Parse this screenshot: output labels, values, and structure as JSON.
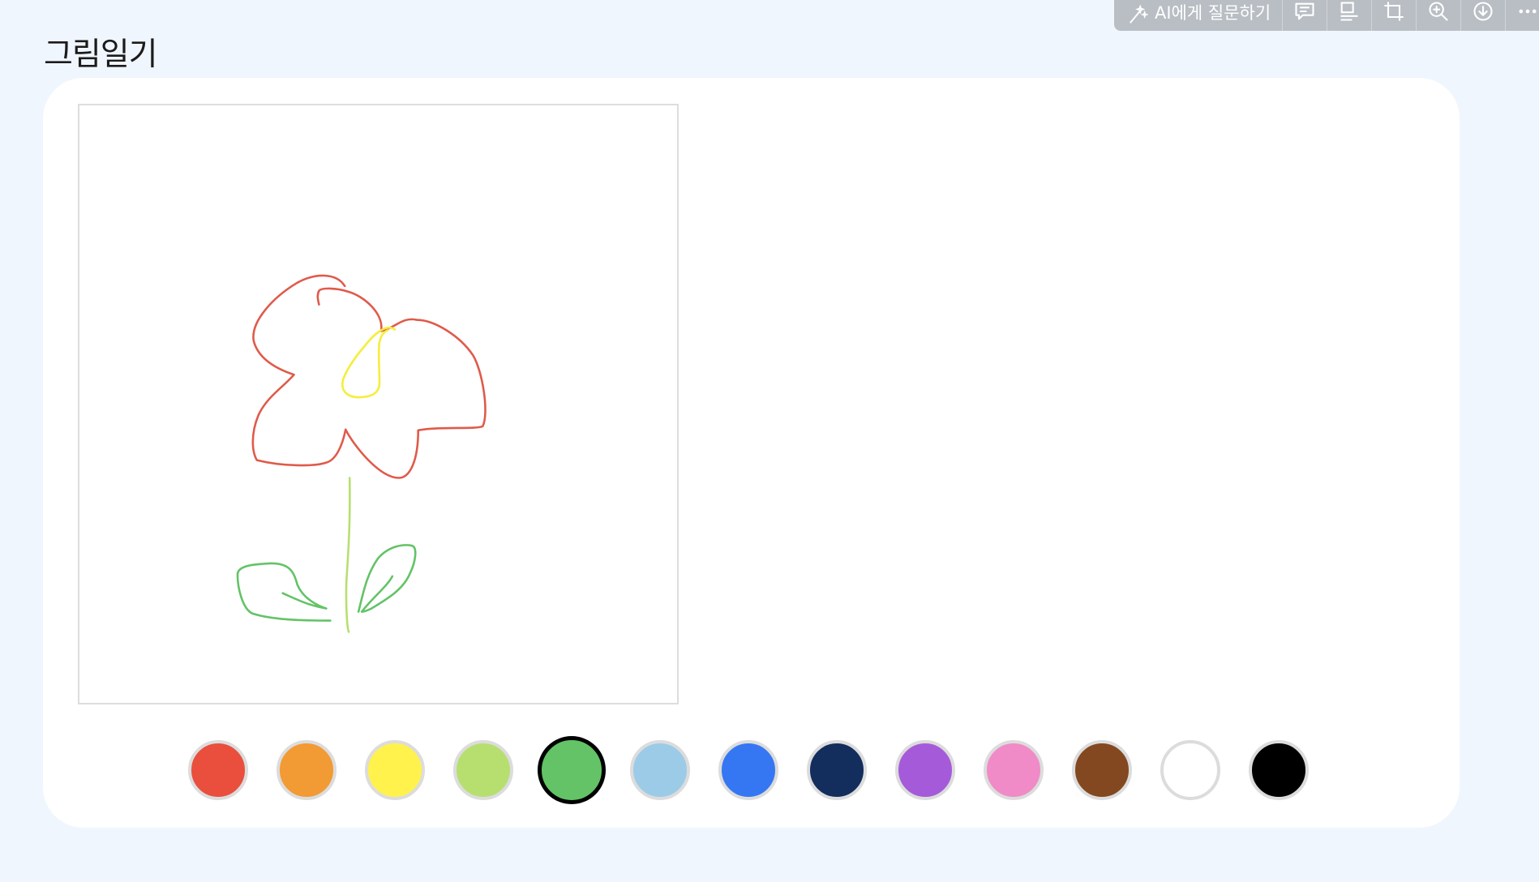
{
  "page": {
    "title": "그림일기"
  },
  "toolbar": {
    "ask_ai_label": "AI에게 질문하기",
    "buttons": [
      {
        "name": "comment-icon"
      },
      {
        "name": "caption-icon"
      },
      {
        "name": "crop-icon"
      },
      {
        "name": "zoom-in-icon"
      },
      {
        "name": "download-icon"
      },
      {
        "name": "more-icon"
      }
    ]
  },
  "palette": {
    "selected": "#63c366",
    "colors": [
      {
        "name": "red",
        "hex": "#e94f3c"
      },
      {
        "name": "orange",
        "hex": "#f29a33"
      },
      {
        "name": "yellow",
        "hex": "#fff24d"
      },
      {
        "name": "light-green",
        "hex": "#b7df70"
      },
      {
        "name": "green",
        "hex": "#63c366"
      },
      {
        "name": "sky-blue",
        "hex": "#9ccbe8"
      },
      {
        "name": "blue",
        "hex": "#3577f2"
      },
      {
        "name": "navy",
        "hex": "#132d5c"
      },
      {
        "name": "purple",
        "hex": "#a55bd9"
      },
      {
        "name": "pink",
        "hex": "#f08bc7"
      },
      {
        "name": "brown",
        "hex": "#834820"
      },
      {
        "name": "white",
        "hex": "#ffffff"
      },
      {
        "name": "black",
        "hex": "#000000"
      }
    ]
  },
  "drawing": {
    "strokes": [
      {
        "name": "petals",
        "color": "#e05a4a"
      },
      {
        "name": "flower-center",
        "color": "#f5ee3a"
      },
      {
        "name": "stem",
        "color": "#b7df70"
      },
      {
        "name": "left-leaf",
        "color": "#63c366"
      },
      {
        "name": "right-leaf",
        "color": "#63c366"
      }
    ]
  }
}
